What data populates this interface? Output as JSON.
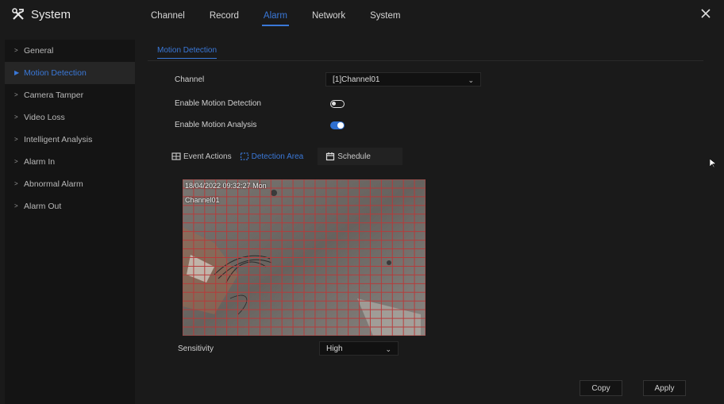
{
  "app": {
    "title": "System"
  },
  "top_tabs": [
    {
      "label": "Channel",
      "active": false
    },
    {
      "label": "Record",
      "active": false
    },
    {
      "label": "Alarm",
      "active": true
    },
    {
      "label": "Network",
      "active": false
    },
    {
      "label": "System",
      "active": false
    }
  ],
  "sidebar": {
    "items": [
      {
        "label": "General",
        "active": false
      },
      {
        "label": "Motion Detection",
        "active": true
      },
      {
        "label": "Camera Tamper",
        "active": false
      },
      {
        "label": "Video Loss",
        "active": false
      },
      {
        "label": "Intelligent Analysis",
        "active": false
      },
      {
        "label": "Alarm In",
        "active": false
      },
      {
        "label": "Abnormal Alarm",
        "active": false
      },
      {
        "label": "Alarm Out",
        "active": false
      }
    ]
  },
  "subtab": {
    "label": "Motion Detection"
  },
  "form": {
    "channel_label": "Channel",
    "channel_value": "[1]Channel01",
    "enable_motion_label": "Enable Motion Detection",
    "enable_motion_on": false,
    "enable_analysis_label": "Enable Motion Analysis",
    "enable_analysis_on": true,
    "sensitivity_label": "Sensitivity",
    "sensitivity_value": "High"
  },
  "area_tabs": {
    "event_actions": "Event Actions",
    "detection_area": "Detection Area",
    "schedule": "Schedule"
  },
  "video": {
    "timestamp": "18/04/2022 09:32:27 Mon",
    "channel_name": "Channel01"
  },
  "buttons": {
    "copy": "Copy",
    "apply": "Apply"
  },
  "colors": {
    "accent": "#3a78d8",
    "grid": "#b83a3a",
    "background": "#1a1a1a"
  }
}
